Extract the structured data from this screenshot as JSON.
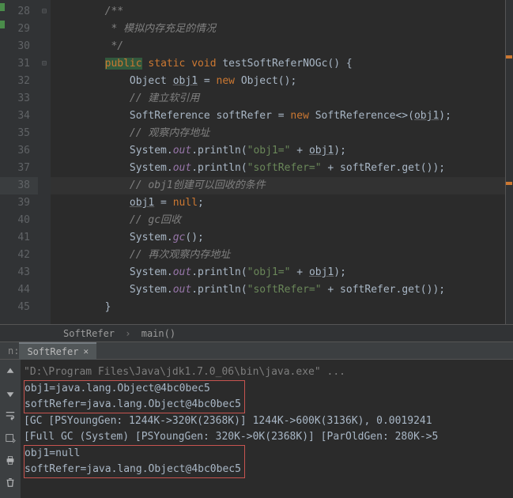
{
  "gutter": {
    "start": 28,
    "end": 45,
    "selected": 38,
    "fold_minus_lines": [
      28,
      31
    ],
    "markers": [
      28,
      29,
      30
    ]
  },
  "code_lines": [
    {
      "n": 28,
      "html": "        <span class='cmt'>/**</span>"
    },
    {
      "n": 29,
      "html": "        <span class='cmt'> * 模拟内存充足的情况</span>"
    },
    {
      "n": 30,
      "html": "        <span class='cmt'> */</span>"
    },
    {
      "n": 31,
      "html": "        <span class='kw-hl'>public</span> <span class='kw'>static</span> <span class='kw'>void</span> testSoftReferNOGc() {"
    },
    {
      "n": 32,
      "html": "            Object <span class='id-u'>obj1</span> = <span class='kw'>new</span> Object();"
    },
    {
      "n": 33,
      "html": "            <span class='cmt'>// 建立软引用</span>"
    },
    {
      "n": 34,
      "html": "            SoftReference softRefer = <span class='kw'>new</span> SoftReference&lt;&gt;(<span class='id-u'>obj1</span>);"
    },
    {
      "n": 35,
      "html": "            <span class='cmt'>// 观察内存地址</span>"
    },
    {
      "n": 36,
      "html": "            System.<span class='fld'>out</span>.println(<span class='str'>\"obj1=\"</span> + <span class='id-u'>obj1</span>);"
    },
    {
      "n": 37,
      "html": "            System.<span class='fld'>out</span>.println(<span class='str'>\"softRefer=\"</span> + softRefer.get());"
    },
    {
      "n": 38,
      "html": "            <span class='cmt'>// obj1创建可以回收的条件</span>"
    },
    {
      "n": 39,
      "html": "            <span class='id-u'>obj1</span> = <span class='kw'>null</span>;"
    },
    {
      "n": 40,
      "html": "            <span class='cmt'>// gc回收</span>"
    },
    {
      "n": 41,
      "html": "            System.<span class='fld'>gc</span>();"
    },
    {
      "n": 42,
      "html": "            <span class='cmt'>// 再次观察内存地址</span>"
    },
    {
      "n": 43,
      "html": "            System.<span class='fld'>out</span>.println(<span class='str'>\"obj1=\"</span> + <span class='id-u'>obj1</span>);"
    },
    {
      "n": 44,
      "html": "            System.<span class='fld'>out</span>.println(<span class='str'>\"softRefer=\"</span> + softRefer.get());"
    },
    {
      "n": 45,
      "html": "        }"
    }
  ],
  "breadcrumb": {
    "class": "SoftRefer",
    "method": "main()"
  },
  "run": {
    "side_label": "n:",
    "tab": "SoftRefer"
  },
  "console": {
    "cmd": "\"D:\\Program Files\\Java\\jdk1.7.0_06\\bin\\java.exe\" ...",
    "l1": "obj1=java.lang.Object@4bc0bec5",
    "l2": "softRefer=java.lang.Object@4bc0bec5",
    "l3": "[GC [PSYoungGen: 1244K->320K(2368K)] 1244K->600K(3136K), 0.0019241",
    "l4": "[Full GC (System) [PSYoungGen: 320K->0K(2368K)] [ParOldGen: 280K->5",
    "l5": "obj1=null",
    "l6": "softRefer=java.lang.Object@4bc0bec5"
  }
}
